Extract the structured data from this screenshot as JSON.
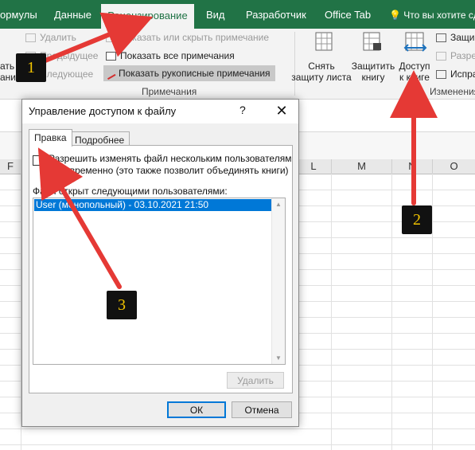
{
  "ribbon_tabs": [
    {
      "label": "ормулы"
    },
    {
      "label": "Данные"
    },
    {
      "label": "Рецензирование"
    },
    {
      "label": "Вид"
    },
    {
      "label": "Разработчик"
    },
    {
      "label": "Office Tab"
    }
  ],
  "tell_me": {
    "text": "Что вы хотите сд"
  },
  "comments_group": {
    "delete": "Удалить",
    "previous": "Предыдущее",
    "next": "Следующее",
    "show_hide": "Показать или скрыть примечание",
    "show_all": "Показать все примечания",
    "show_ink": "Показать рукописные примечания",
    "group_label": "Примечания",
    "left_cut_1": "ать",
    "left_cut_2": "ание"
  },
  "protect_group": {
    "unprotect_sheet": [
      "Снять",
      "защиту листа"
    ],
    "protect_workbook": [
      "Защитить",
      "книгу"
    ],
    "share_workbook": [
      "Доступ",
      "к книге"
    ],
    "right_1": "Защи",
    "right_2": "Разре",
    "right_3": "Испра",
    "group_label": "Изменения"
  },
  "columns": [
    "F",
    "L",
    "M",
    "N",
    "O"
  ],
  "dialog": {
    "title": "Управление доступом к файлу",
    "help": "?",
    "close": "✕",
    "tabs": [
      "Правка",
      "Подробнее"
    ],
    "allow_multi_line1": "Разрешить изменять файл нескольким пользователям",
    "allow_multi_line2": "одновременно (это также позволит объединять книги)",
    "list_label": "Файл открыт следующими пользователями:",
    "users": [
      "User (монопольный) - 03.10.2021 21:50"
    ],
    "remove_button": "Удалить",
    "ok_button": "ОК",
    "cancel_button": "Отмена",
    "allow_multi_checked": false
  },
  "annotations": [
    {
      "label": "1"
    },
    {
      "label": "2"
    },
    {
      "label": "3"
    }
  ],
  "colors": {
    "excel_green": "#217346",
    "arrow_red": "#e53935",
    "badge_bg": "#111111",
    "badge_text": "#f2c400",
    "selection": "#0078d7"
  }
}
